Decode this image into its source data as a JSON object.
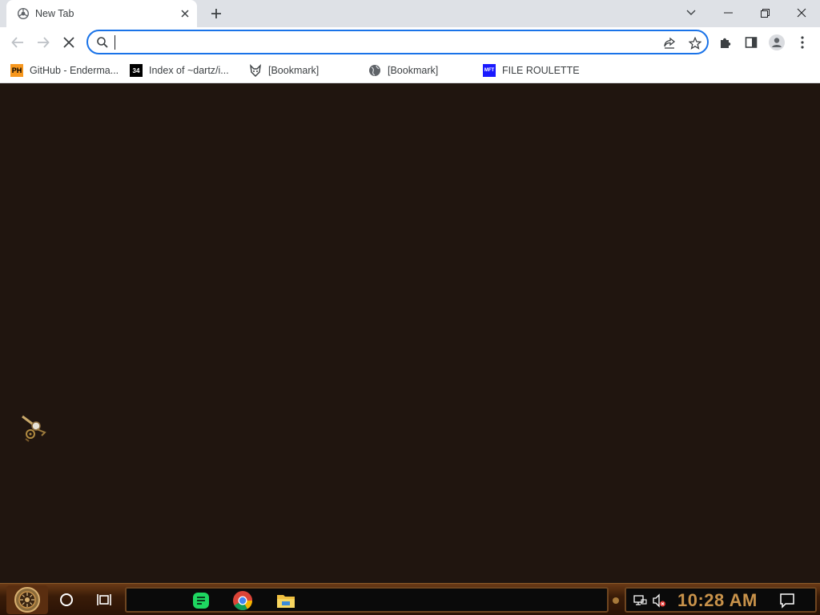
{
  "tab": {
    "title": "New Tab",
    "favicon": "chrome-newtab-icon"
  },
  "window_controls": [
    "chevron-down-icon",
    "minimize-icon",
    "restore-icon",
    "close-icon"
  ],
  "toolbar": {
    "back": "back-arrow-icon",
    "forward": "forward-arrow-icon",
    "stop": "stop-icon",
    "omnibox_value": "",
    "omnibox_placeholder": "",
    "extensions": "puzzle-icon",
    "side_panel": "side-panel-icon",
    "profile": "profile-icon",
    "menu": "kebab-menu-icon"
  },
  "bookmarks": [
    {
      "label": "GitHub - Enderma...",
      "icon": "PH",
      "icon_bg": "#f7971d",
      "icon_fg": "#000000"
    },
    {
      "label": "Index of ~dartz/i...",
      "icon": "34",
      "icon_bg": "#000000",
      "icon_fg": "#ffffff"
    },
    {
      "label": "[Bookmark]",
      "icon": "fox-icon"
    },
    {
      "label": "[Bookmark]",
      "icon": "globe-icon"
    },
    {
      "label": "FILE ROULETTE",
      "icon": "MFT",
      "icon_bg": "#1a1aff",
      "icon_fg": "#ffffff"
    }
  ],
  "taskbar": {
    "clock": "10:28 AM",
    "apps": [
      "spotify-like-green-app-icon",
      "chrome-icon",
      "file-explorer-icon"
    ],
    "tray": [
      "network-icon",
      "volume-muted-icon",
      "notification-icon"
    ]
  },
  "colors": {
    "accent": "#1a73e8",
    "content_bg": "#20150f",
    "tabstrip_bg": "#dee1e6",
    "clock": "#c8924a"
  }
}
